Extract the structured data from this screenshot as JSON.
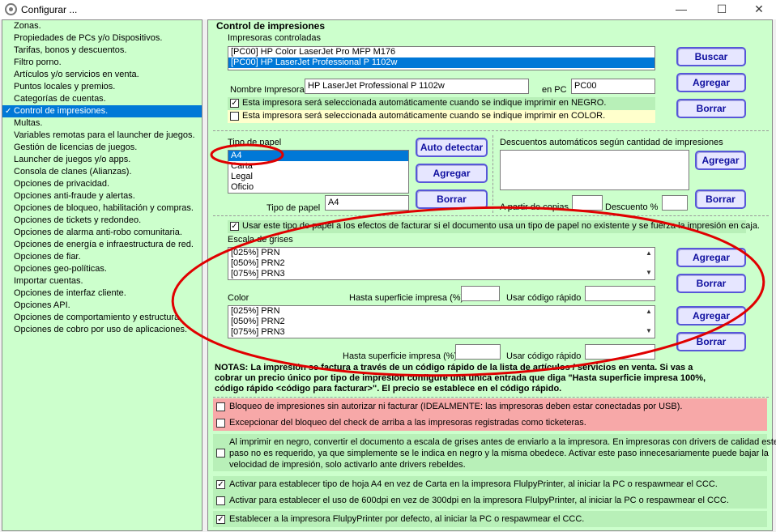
{
  "window": {
    "title": "Configurar ...",
    "minimize_glyph": "—",
    "maximize_glyph": "☐",
    "close_glyph": "✕"
  },
  "sidebar": {
    "items": [
      {
        "label": "Zonas."
      },
      {
        "label": "Propiedades de PCs y/o Dispositivos."
      },
      {
        "label": "Tarifas, bonos y descuentos."
      },
      {
        "label": "Filtro porno."
      },
      {
        "label": "Artículos y/o servicios en venta."
      },
      {
        "label": "Puntos locales y premios."
      },
      {
        "label": "Categorías de cuentas."
      },
      {
        "label": "Control de impresiones."
      },
      {
        "label": "Multas."
      },
      {
        "label": "Variables remotas para el launcher de juegos."
      },
      {
        "label": "Gestión de licencias de juegos."
      },
      {
        "label": "Launcher de juegos y/o apps."
      },
      {
        "label": "Consola de clanes (Alianzas)."
      },
      {
        "label": "Opciones de privacidad."
      },
      {
        "label": "Opciones anti-fraude y alertas."
      },
      {
        "label": "Opciones de bloqueo, habilitación y compras."
      },
      {
        "label": "Opciones de tickets y redondeo."
      },
      {
        "label": "Opciones de alarma anti-robo comunitaria."
      },
      {
        "label": "Opciones de energía e infraestructura de red."
      },
      {
        "label": "Opciones de fiar."
      },
      {
        "label": "Opciones geo-políticas."
      },
      {
        "label": "Importar cuentas."
      },
      {
        "label": "Opciones de interfaz cliente."
      },
      {
        "label": "Opciones API."
      },
      {
        "label": "Opciones de comportamiento y estructura."
      },
      {
        "label": "Opciones de cobro por uso de aplicaciones."
      }
    ],
    "selected_index": 7,
    "check_glyph": "✓"
  },
  "main": {
    "group_title": "Control de impresiones",
    "printers": {
      "label": "Impresoras controladas",
      "items": [
        "[PC00] HP Color LaserJet Pro MFP M176",
        "[PC00] HP LaserJet Professional P 1102w"
      ],
      "selected_index": 1,
      "name_label": "Nombre Impresora",
      "name_value": "HP LaserJet Professional P 1102w",
      "pc_label": "en PC",
      "pc_value": "PC00",
      "chk_black": "Esta impresora será seleccionada automáticamente cuando se indique imprimir en NEGRO.",
      "chk_black_checked": true,
      "chk_color": "Esta impresora será seleccionada automáticamente cuando se indique imprimir en COLOR.",
      "chk_color_checked": false,
      "btn_search": "Buscar",
      "btn_add": "Agregar",
      "btn_delete": "Borrar"
    },
    "paper": {
      "label": "Tipo de papel",
      "items": [
        "A4",
        "Carta",
        "Legal",
        "Oficio"
      ],
      "selected_index": 0,
      "field_label": "Tipo de papel",
      "field_value": "A4",
      "btn_autodetect": "Auto detectar",
      "btn_add": "Agregar",
      "btn_delete": "Borrar"
    },
    "discounts": {
      "label": "Descuentos automáticos según cantidad de impresiones",
      "from_copies_label": "A partir de copias",
      "from_copies_value": "",
      "discount_label": "Descuento %",
      "discount_value": "",
      "btn_add": "Agregar",
      "btn_delete": "Borrar"
    },
    "use_paper_chk": "Usar este tipo de papel a los efectos de facturar si el documento usa un tipo de papel no existente y se fuerza la impresión en caja.",
    "use_paper_checked": true,
    "grayscale": {
      "label": "Escala de grises",
      "items": [
        "[025%] PRN",
        "[050%] PRN2",
        "[075%] PRN3"
      ],
      "surface_label": "Hasta superficie impresa (%)",
      "surface_value": "",
      "code_label": "Usar código rápido",
      "code_value": "",
      "btn_add": "Agregar",
      "btn_delete": "Borrar"
    },
    "color": {
      "label": "Color",
      "items": [
        "[025%] PRN",
        "[050%] PRN2",
        "[075%] PRN3"
      ],
      "surface_label": "Hasta superficie impresa (%)",
      "surface_value": "",
      "code_label": "Usar código rápido",
      "code_value": "",
      "btn_add": "Agregar",
      "btn_delete": "Borrar"
    },
    "notes": [
      "NOTAS: La impresión se factura a través de un código rápido de la lista de artículos / servicios en venta. Si vas a",
      "cobrar un precio único por tipo de impresión configure una única entrada que diga \"Hasta superficie impresa 100%,",
      "código rápido <código para facturar>\". El precio se establece en el código rápido."
    ],
    "options": {
      "block_unauthorized": "Bloqueo de impresiones sin autorizar ni facturar (IDEALMENTE: las impresoras deben estar conectadas por USB).",
      "block_unauthorized_checked": false,
      "except_ticket": "Excepcionar del bloqueo del check de arriba a las impresoras registradas como ticketeras.",
      "except_ticket_checked": false,
      "grayscale_convert_lines": [
        "Al imprimir en negro, convertir el documento a escala de grises antes de enviarlo a la impresora. En impresoras con drivers de calidad este",
        "paso no es requerido, ya que simplemente se le indica en negro y la misma obedece. Activar este paso innecesariamente puede bajar la",
        "velocidad de impresión, solo activarlo ante drivers rebeldes."
      ],
      "grayscale_convert_checked": false,
      "a4_default": "Activar para establecer tipo de hoja A4 en vez de Carta en la impresora FlulpyPrinter, al iniciar la PC o respawmear el CCC.",
      "a4_default_checked": true,
      "dpi600": "Activar para establecer el uso de 600dpi en vez de 300dpi en la impresora FlulpyPrinter, al iniciar la PC o respawmear el CCC.",
      "dpi600_checked": false,
      "default_printer": "Establecer a la impresora FlulpyPrinter por defecto, al iniciar la PC o respawmear el CCC.",
      "default_printer_checked": true
    },
    "scroll_up_glyph": "▲",
    "scroll_down_glyph": "▼"
  },
  "colors": {
    "selection": "#0078d7",
    "annotation_red": "#e00000",
    "panel_green": "#ccffcc",
    "warning_pink": "#f7a8a8",
    "note_yellow": "#ffffcc"
  }
}
